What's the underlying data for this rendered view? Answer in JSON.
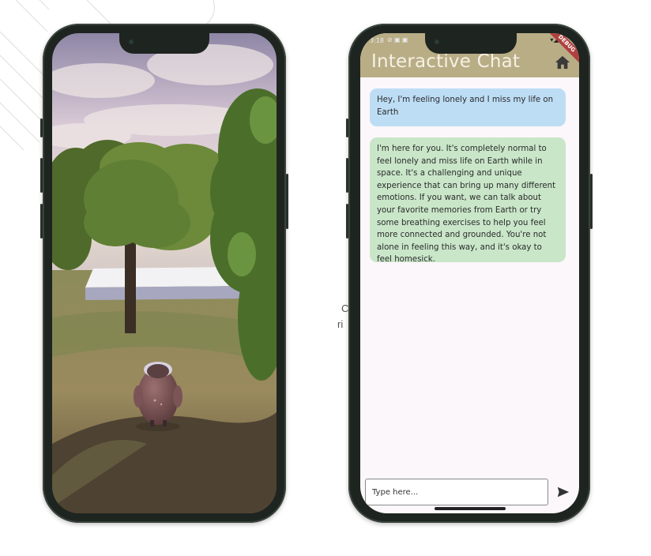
{
  "chat_app": {
    "status_time": "3:18",
    "title": "Interactive Chat",
    "debug_banner": "DEBUG",
    "messages": [
      {
        "role": "user",
        "text": "Hey, I'm feeling lonely and I miss my life on Earth"
      },
      {
        "role": "assistant",
        "text": "I'm here for you. It's completely normal to feel lonely and miss life on Earth while in space. It's a challenging and unique experience that can bring up many different emotions. If you want, we can talk about your favorite memories from Earth or try some breathing exercises to help you feel more connected and grounded. You're not alone in feeling this way, and it's okay to feel homesick."
      }
    ],
    "input": {
      "placeholder": "Type here..."
    }
  },
  "background_text": {
    "line1": "C",
    "line2": "ri"
  },
  "colors": {
    "app_bar": "#b8ad85",
    "user_bubble": "#bdddf5",
    "assistant_bubble": "#c9e6c9",
    "phone_frame": "#1e2420"
  },
  "icons": [
    "home-icon",
    "send-icon",
    "camera-icon"
  ]
}
